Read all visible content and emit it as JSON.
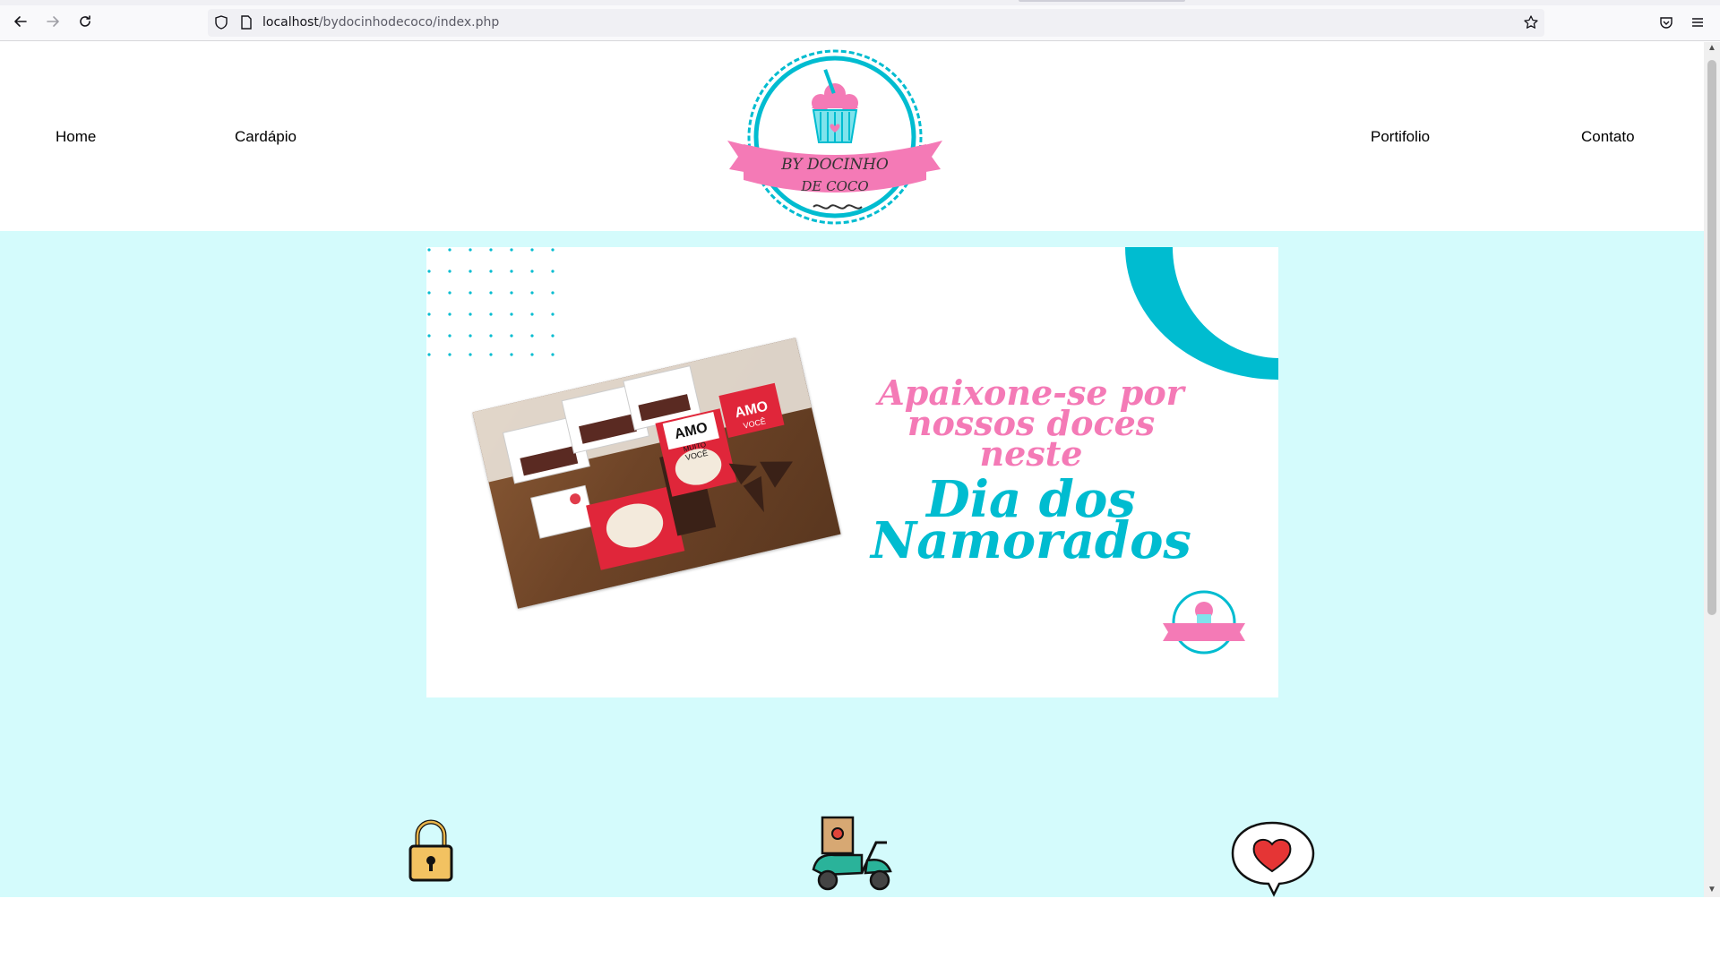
{
  "browser": {
    "url_host": "localhost",
    "url_path": "/bydocinhodecoco/index.php"
  },
  "nav": {
    "items": [
      "Home",
      "Cardápio",
      "Portifolio",
      "Contato"
    ]
  },
  "logo": {
    "line1": "BY DOCINHO",
    "line2": "DE COCO"
  },
  "banner": {
    "headline_line1": "Apaixone-se por",
    "headline_line2": "nossos doces",
    "headline_line3": "neste",
    "headline_teal_line1": "Dia dos",
    "headline_teal_line2": "Namorados",
    "photo_labels": [
      "AMO",
      "AMO",
      "MUITO",
      "VOCÊ",
      "VOCÊ"
    ]
  },
  "features": {
    "icons": [
      "padlock-icon",
      "delivery-scooter-icon",
      "heart-speech-bubble-icon"
    ]
  },
  "colors": {
    "accent_teal": "#00bcd0",
    "accent_pink": "#f47ab6",
    "hero_bg": "#d4fbfc"
  }
}
